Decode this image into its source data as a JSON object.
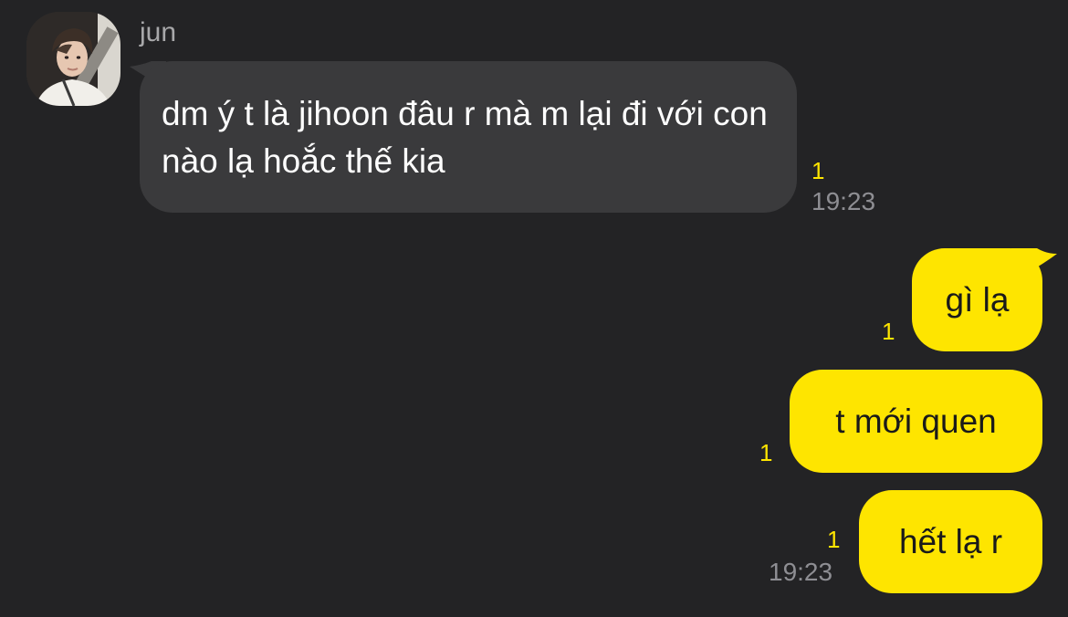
{
  "chat": {
    "sender_name": "jun",
    "avatar_icon": "profile-photo",
    "incoming_message": {
      "text": "dm ý t là jihoon đâu r mà m lại đi với con nào lạ hoắc thế kia",
      "unread_count": "1",
      "time": "19:23"
    },
    "outgoing_messages": [
      {
        "text": "gì lạ",
        "unread_count": "1"
      },
      {
        "text": "t mới quen",
        "unread_count": "1"
      },
      {
        "text": "hết lạ r",
        "unread_count": "1",
        "time": "19:23"
      }
    ]
  },
  "colors": {
    "background": "#232325",
    "incoming_bubble": "#3a3a3c",
    "outgoing_bubble": "#fee500",
    "unread_count": "#fee500",
    "timestamp": "#8e8e93",
    "sender_name": "#a8a8aa"
  }
}
